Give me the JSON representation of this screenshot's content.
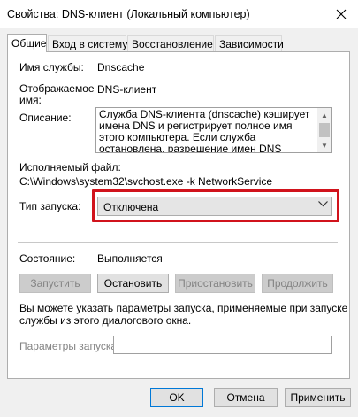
{
  "window": {
    "title": "Свойства: DNS-клиент (Локальный компьютер)"
  },
  "tabs": [
    {
      "label": "Общие"
    },
    {
      "label": "Вход в систему"
    },
    {
      "label": "Восстановление"
    },
    {
      "label": "Зависимости"
    }
  ],
  "general": {
    "service_name_label": "Имя службы:",
    "service_name_value": "Dnscache",
    "display_name_label_line1": "Отображаемое",
    "display_name_label_line2": "имя:",
    "display_name_value": "DNS-клиент",
    "description_label": "Описание:",
    "description_text": "Служба DNS-клиента (dnscache) кэширует имена DNS и регистрирует полное имя этого компьютера. Если служба остановлена, разрешение имен DNS будет продолжаться, но",
    "exe_label": "Исполняемый файл:",
    "exe_path": "C:\\Windows\\system32\\svchost.exe -k NetworkService",
    "startup_type_label": "Тип запуска:",
    "startup_type_value": "Отключена",
    "status_label": "Состояние:",
    "status_value": "Выполняется",
    "buttons": {
      "start": "Запустить",
      "stop": "Остановить",
      "pause": "Приостановить",
      "resume": "Продолжить"
    },
    "hint_line1": "Вы можете указать параметры запуска, применяемые при запуске",
    "hint_line2": "службы из этого диалогового окна.",
    "params_label": "Параметры запуска:",
    "params_value": ""
  },
  "footer": {
    "ok": "OK",
    "cancel": "Отмена",
    "apply": "Применить"
  },
  "colors": {
    "highlight_border": "#d1131c",
    "focus_border": "#0078d7"
  }
}
